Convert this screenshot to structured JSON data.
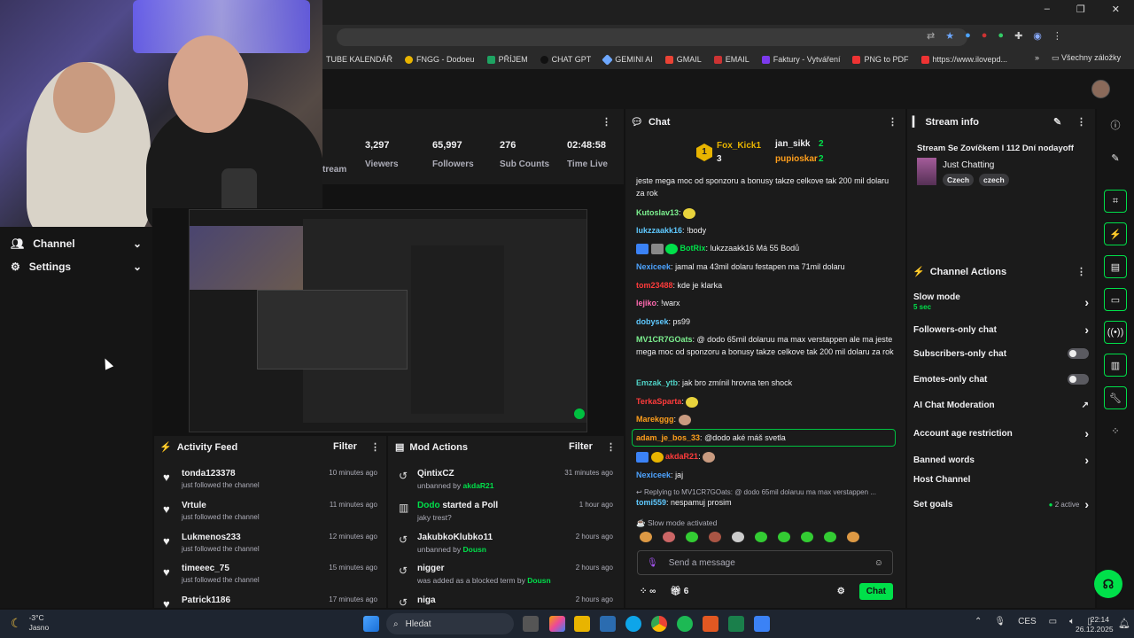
{
  "browser": {
    "bookmarks": [
      "TUBE KALENDÁŘ",
      "FNGG - Dodoeu",
      "PŘÍJEM",
      "CHAT GPT",
      "GEMINI AI",
      "GMAIL",
      "EMAIL",
      "Faktury - Vytváření",
      "PNG to PDF",
      "https://www.ilovepd..."
    ],
    "bookmarks_more": "»",
    "all_bookmarks": "Všechny záložky",
    "window_controls": [
      "–",
      "❐",
      "✕"
    ]
  },
  "sidebar": {
    "items": [
      {
        "label": "Channel",
        "icon": "people-icon"
      },
      {
        "label": "Settings",
        "icon": "gear-icon"
      }
    ]
  },
  "stats": {
    "partial_label": "tream",
    "items": [
      {
        "value": "3,297",
        "label": "Viewers"
      },
      {
        "value": "65,997",
        "label": "Followers"
      },
      {
        "value": "276",
        "label": "Sub Counts"
      },
      {
        "value": "02:48:58",
        "label": "Time Live"
      }
    ]
  },
  "activity": {
    "title": "Activity Feed",
    "filter": "Filter",
    "items": [
      {
        "name": "tonda123378",
        "sub": "just followed the channel",
        "time": "10 minutes ago"
      },
      {
        "name": "Vrtule",
        "sub": "just followed the channel",
        "time": "11 minutes ago"
      },
      {
        "name": "Lukmenos233",
        "sub": "just followed the channel",
        "time": "12 minutes ago"
      },
      {
        "name": "timeeec_75",
        "sub": "just followed the channel",
        "time": "15 minutes ago"
      },
      {
        "name": "Patrick1186",
        "sub": "",
        "time": "17 minutes ago"
      }
    ]
  },
  "mod": {
    "title": "Mod Actions",
    "filter": "Filter",
    "items": [
      {
        "name": "QintixCZ",
        "pre": "unbanned by",
        "by": "akdaR21",
        "time": "31 minutes ago",
        "name_green": false
      },
      {
        "name": "Dodo",
        "name_suffix": " started a Poll",
        "pre": "jaky trest?",
        "by": "",
        "time": "1 hour ago",
        "name_green": true
      },
      {
        "name": "JakubkoKlubko11",
        "pre": "unbanned by",
        "by": "Dousn",
        "time": "2 hours ago",
        "name_green": false
      },
      {
        "name": "nigger",
        "pre": "was added as a blocked term by",
        "by": "Dousn",
        "time": "2 hours ago",
        "name_green": false
      },
      {
        "name": "niga",
        "pre": "",
        "by": "",
        "time": "2 hours ago",
        "name_green": false
      }
    ]
  },
  "chat": {
    "title": "Chat",
    "leaders": {
      "first": "Fox_Kick1",
      "first_count": "3",
      "second": "jan_sikk",
      "second_count": "2",
      "third": "pupioskar",
      "third_count": "2",
      "rank": "1"
    },
    "messages": [
      {
        "user": "",
        "color": "#efeff1",
        "text": "jeste mega moc od sponzoru a bonusy takze celkove tak 200 mil dolaru za rok"
      },
      {
        "user": "Kutoslav13",
        "color": "#7cf08f",
        "text": ""
      },
      {
        "user": "lukzzaakk16",
        "color": "#5fc9ff",
        "text": "!body"
      },
      {
        "user": "BotRix",
        "color": "#00e04a",
        "text": "lukzzaakk16 Má 55 Bodů"
      },
      {
        "user": "Nexiceek",
        "color": "#4da3ff",
        "text": "jamal ma 43mil dolaru festapen ma 71mil dolaru"
      },
      {
        "user": "tom23488",
        "color": "#ff3b3b",
        "text": "kde je klarka"
      },
      {
        "user": "lejiko",
        "color": "#ff6ab0",
        "text": "!warx"
      },
      {
        "user": "dobysek",
        "color": "#5fc9ff",
        "text": "ps99"
      },
      {
        "user": "MV1CR7GOats",
        "color": "#7cf08f",
        "text": "@ dodo 65mil dolaruu ma max verstappen ale ma jeste mega moc od sponzoru a bonusy takze celkove tak 200 mil dolaru za rok"
      },
      {
        "user": "Emzak_ytb",
        "color": "#4fd1c5",
        "text": "jak bro zmínil hrovna ten shock"
      },
      {
        "user": "TerkaSparta",
        "color": "#ff3b3b",
        "text": ""
      },
      {
        "user": "Marekggg",
        "color": "#ff9f1c",
        "text": ""
      },
      {
        "user": "adam_je_bos_33",
        "color": "#ff9f1c",
        "text": "@dodo aké máš svetla"
      },
      {
        "user": "akdaR21",
        "color": "#ff3b3b",
        "text": ""
      },
      {
        "user": "Nexiceek",
        "color": "#4da3ff",
        "text": "jaj"
      },
      {
        "user": "tomi559",
        "color": "#5fc9ff",
        "text": "nespamuj prosim"
      }
    ],
    "reply_to": "Replying to MV1CR7GOats: @ dodo 65mil dolaruu ma max verstappen ...",
    "slow_mode": "Slow mode activated",
    "placeholder": "Send a message",
    "count": "6",
    "send": "Chat"
  },
  "stream_info": {
    "title": "Stream info",
    "stream_title": "Stream Se Zovíčkem l 112 Dní nodayoff",
    "category": "Just Chatting",
    "tags": [
      "Czech",
      "czech"
    ]
  },
  "channel_actions": {
    "title": "Channel Actions",
    "slow_mode": "Slow mode",
    "slow_value": "5 sec",
    "items": [
      "Followers-only chat",
      "Subscribers-only chat",
      "Emotes-only chat",
      "AI Chat Moderation",
      "Account age restriction",
      "Banned words",
      "Host Channel",
      "Set goals"
    ],
    "goals_active": "2 active"
  },
  "taskbar": {
    "weather_temp": "-3°C",
    "weather_desc": "Jasno",
    "search": "Hledat",
    "lang": "CES",
    "time": "22:14",
    "date": "26.12.2025"
  },
  "colors": {
    "accent": "#00e04a",
    "bg": "#121212",
    "panel": "#1b1b1b"
  }
}
